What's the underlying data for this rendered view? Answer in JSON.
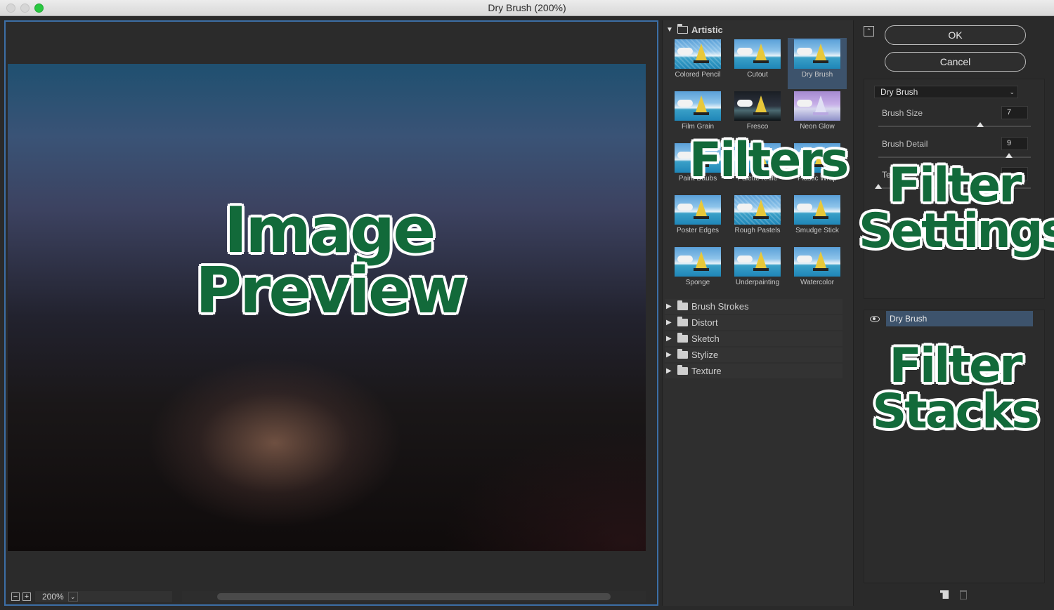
{
  "window": {
    "title": "Dry Brush (200%)"
  },
  "preview": {
    "zoom": "200%",
    "overlay_line1": "Image",
    "overlay_line2": "Preview"
  },
  "gallery": {
    "overlay": "Filters",
    "open_category": "Artistic",
    "filters": [
      "Colored Pencil",
      "Cutout",
      "Dry Brush",
      "Film Grain",
      "Fresco",
      "Neon Glow",
      "Paint Daubs",
      "Palette Knife",
      "Plastic Wrap",
      "Poster Edges",
      "Rough Pastels",
      "Smudge Stick",
      "Sponge",
      "Underpainting",
      "Watercolor"
    ],
    "selected_filter": "Dry Brush",
    "collapsed_categories": [
      "Brush Strokes",
      "Distort",
      "Sketch",
      "Stylize",
      "Texture"
    ]
  },
  "settings": {
    "ok_label": "OK",
    "cancel_label": "Cancel",
    "filter_select": "Dry Brush",
    "brush_size_label": "Brush Size",
    "brush_size_value": "7",
    "brush_size_level": 0.7,
    "brush_detail_label": "Brush Detail",
    "brush_detail_value": "9",
    "brush_detail_level": 0.9,
    "texture_label_partial": "Tex",
    "texture_level": 0.0,
    "overlay_line1": "Filter",
    "overlay_line2": "Settings"
  },
  "stack": {
    "layers": [
      "Dry Brush"
    ],
    "overlay_line1": "Filter",
    "overlay_line2": "Stacks"
  },
  "icons": {
    "collapse": "collapse-icon",
    "eye": "eye-icon",
    "new_layer": "new-effect-layer-icon",
    "trash": "trash-icon",
    "folder": "folder-icon"
  }
}
